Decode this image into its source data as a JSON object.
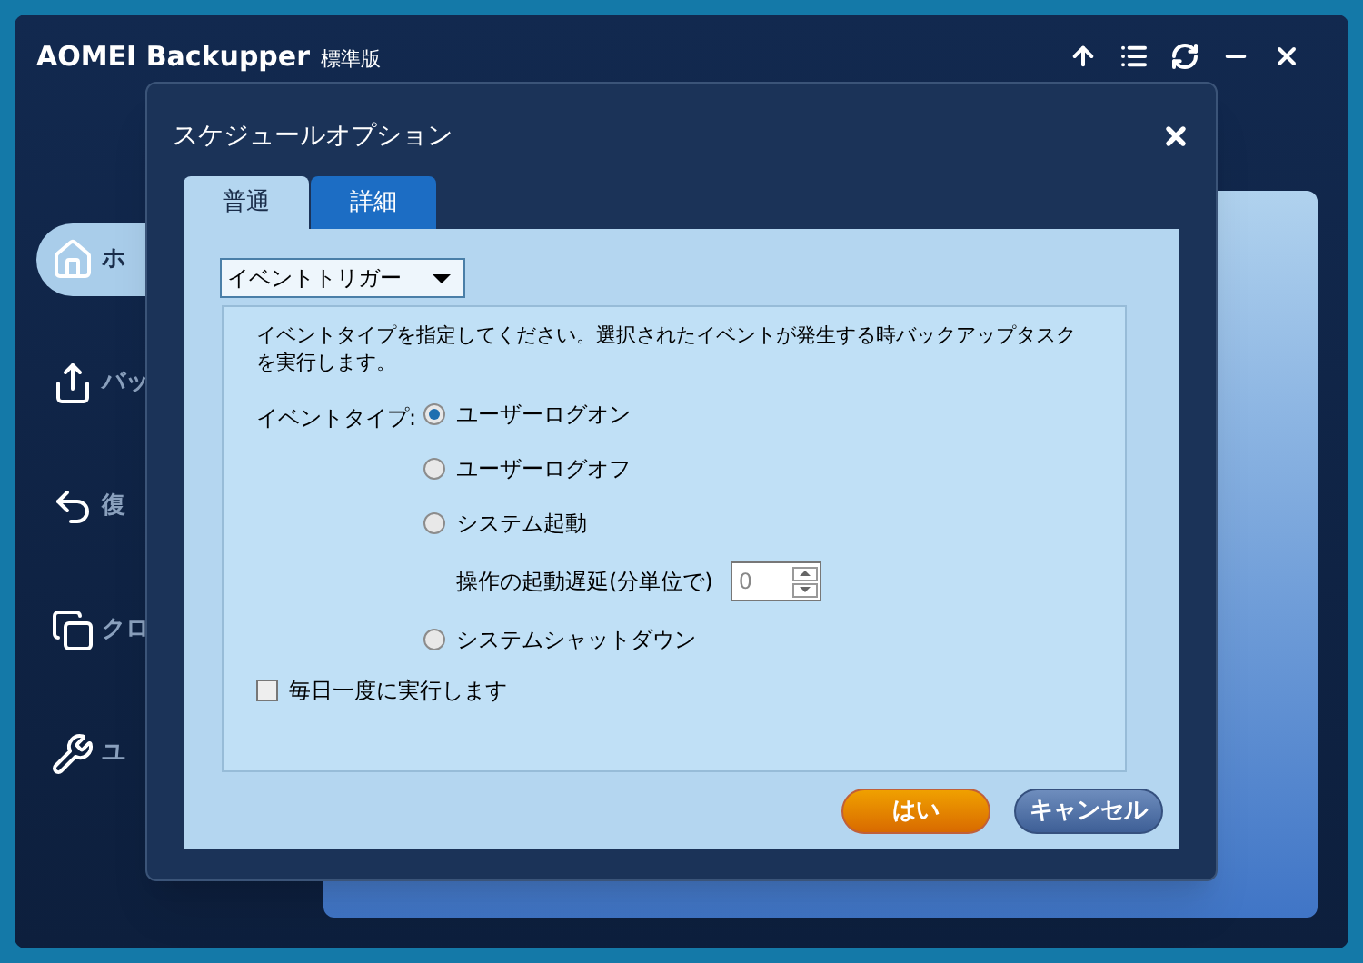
{
  "app": {
    "title": "AOMEI Backupper",
    "edition": "標準版"
  },
  "toolbar": [
    {
      "kind": "upgrade"
    },
    {
      "kind": "menu"
    },
    {
      "kind": "refresh"
    },
    {
      "kind": "minimize"
    },
    {
      "kind": "close"
    }
  ],
  "sidebar": {
    "items": [
      {
        "label": "ホ",
        "kind": "home",
        "selected": true
      },
      {
        "label": "バッ",
        "kind": "backup",
        "selected": false
      },
      {
        "label": "復",
        "kind": "restore",
        "selected": false
      },
      {
        "label": "クロ",
        "kind": "clone",
        "selected": false
      },
      {
        "label": "ユ",
        "kind": "tools",
        "selected": false
      }
    ]
  },
  "dialog": {
    "title": "スケジュールオプション",
    "tabs": [
      {
        "label": "普通",
        "selected": true
      },
      {
        "label": "詳細",
        "selected": false
      }
    ],
    "trigger_select": {
      "value": "イベントトリガー"
    },
    "description": "イベントタイプを指定してください。選択されたイベントが発生する時バックアップタスクを実行します。",
    "event_type_label": "イベントタイプ:",
    "options": [
      {
        "kind": "radio",
        "label": "ユーザーログオン",
        "selected": true
      },
      {
        "kind": "radio",
        "label": "ユーザーログオフ",
        "selected": false
      },
      {
        "kind": "radio",
        "label": "システム起動",
        "selected": false
      },
      {
        "kind": "delay",
        "label": "操作の起動遅延(分単位で)",
        "value": "0"
      },
      {
        "kind": "radio",
        "label": "システムシャットダウン",
        "selected": false
      }
    ],
    "daily_once": {
      "label": "毎日一度に実行します",
      "checked": false
    },
    "buttons": [
      {
        "kind": "primary",
        "label": "はい"
      },
      {
        "kind": "secondary",
        "label": "キャンセル"
      }
    ]
  }
}
